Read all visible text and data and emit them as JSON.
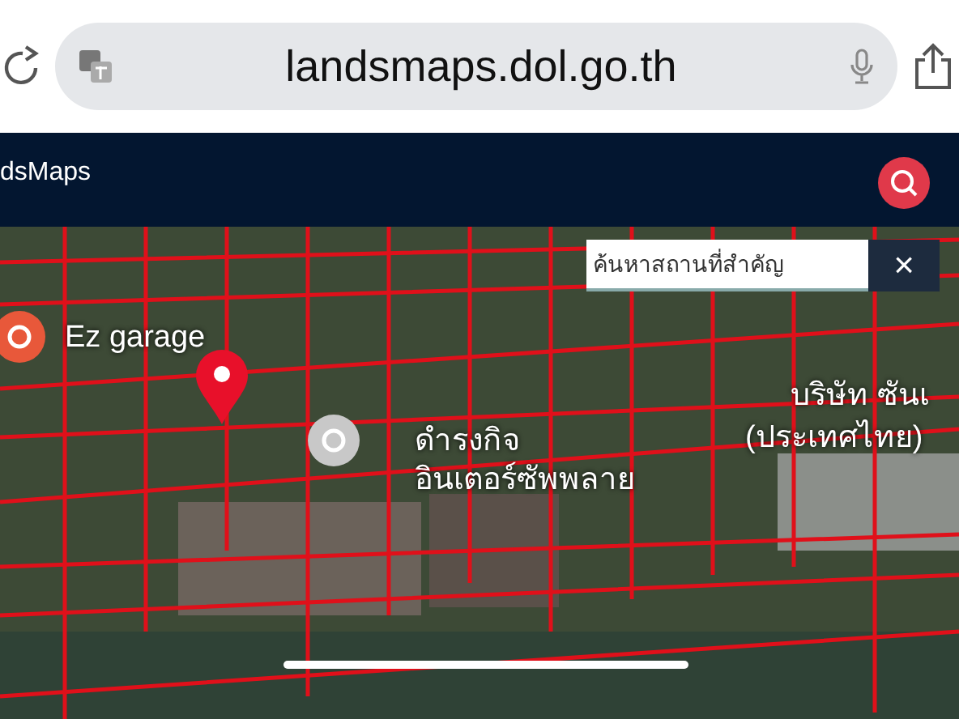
{
  "browser": {
    "url": "landsmaps.dol.go.th"
  },
  "app_bar": {
    "title": "dsMaps"
  },
  "place_search": {
    "placeholder": "ค้นหาสถานที่สำคัญ",
    "close": "×"
  },
  "map": {
    "labels": [
      {
        "text": "Ez garage",
        "kind": "garage"
      },
      {
        "text": "ดำรงกิจ",
        "kind": "place"
      },
      {
        "text": "อินเตอร์ซัพพลาย",
        "kind": "plain"
      },
      {
        "text": "บริษัท ซันเ",
        "kind": "plain"
      },
      {
        "text": "(ประเทศไทย)",
        "kind": "plain"
      }
    ]
  }
}
